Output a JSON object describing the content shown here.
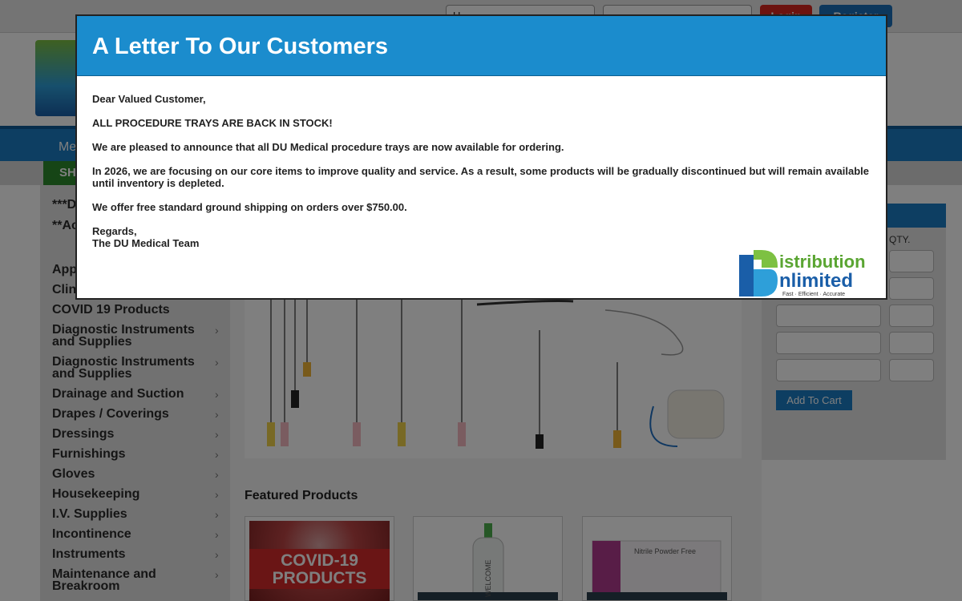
{
  "topbar": {
    "username_value": "U",
    "password_value": "",
    "login_label": "Login",
    "register_label": "Register"
  },
  "nav": {
    "first_label": "Me"
  },
  "shop_tab": "SH",
  "sidebar": {
    "items": [
      {
        "label": "***D",
        "chevron": false
      },
      {
        "label": "**Ac Item Effe",
        "chevron": false
      },
      {
        "label": "App",
        "chevron": false
      },
      {
        "label": "Clin",
        "chevron": false
      },
      {
        "label": "COVID 19 Products",
        "chevron": false
      },
      {
        "label": "Diagnostic Instruments and Supplies",
        "chevron": true
      },
      {
        "label": "Diagnostic Instruments and Supplies",
        "chevron": true
      },
      {
        "label": "Drainage and Suction",
        "chevron": true
      },
      {
        "label": "Drapes / Coverings",
        "chevron": true
      },
      {
        "label": "Dressings",
        "chevron": true
      },
      {
        "label": "Furnishings",
        "chevron": true
      },
      {
        "label": "Gloves",
        "chevron": true
      },
      {
        "label": "Housekeeping",
        "chevron": true
      },
      {
        "label": "I.V. Supplies",
        "chevron": true
      },
      {
        "label": "Incontinence",
        "chevron": true
      },
      {
        "label": "Instruments",
        "chevron": true
      },
      {
        "label": "Maintenance and Breakroom",
        "chevron": true
      }
    ],
    "chevron_glyph": "›"
  },
  "featured": {
    "title": "Featured Products",
    "covid_line1": "COVID-19",
    "covid_line2": "PRODUCTS",
    "bottle_label": "WELCOME",
    "gloves_label": "Nitrile Powder Free"
  },
  "quick_order": {
    "qty_label": "QTY.",
    "add_label": "Add To Cart"
  },
  "modal": {
    "title": "A Letter To Our Customers",
    "greeting": "Dear Valued Customer,",
    "line1": "ALL PROCEDURE TRAYS ARE BACK IN STOCK!",
    "line2": "We are pleased to announce that all DU Medical procedure trays are now available for ordering.",
    "line3": "In 2026, we are focusing on our core items to improve quality and service. As a result, some products will be gradually discontinued but will remain available until inventory is depleted.",
    "line4": "We offer free standard ground shipping on orders over $750.00.",
    "regards": "Regards,",
    "signature": "The DU Medical Team"
  },
  "logo": {
    "word1": "istribution",
    "word2": "nlimited",
    "tagline": "Fast · Efficient · Accurate"
  },
  "colors": {
    "modal_header": "#1b8ccd",
    "login": "#d9271f",
    "register": "#1a6fb8",
    "logo_green": "#7dc142",
    "logo_blue": "#1a5ea8"
  }
}
